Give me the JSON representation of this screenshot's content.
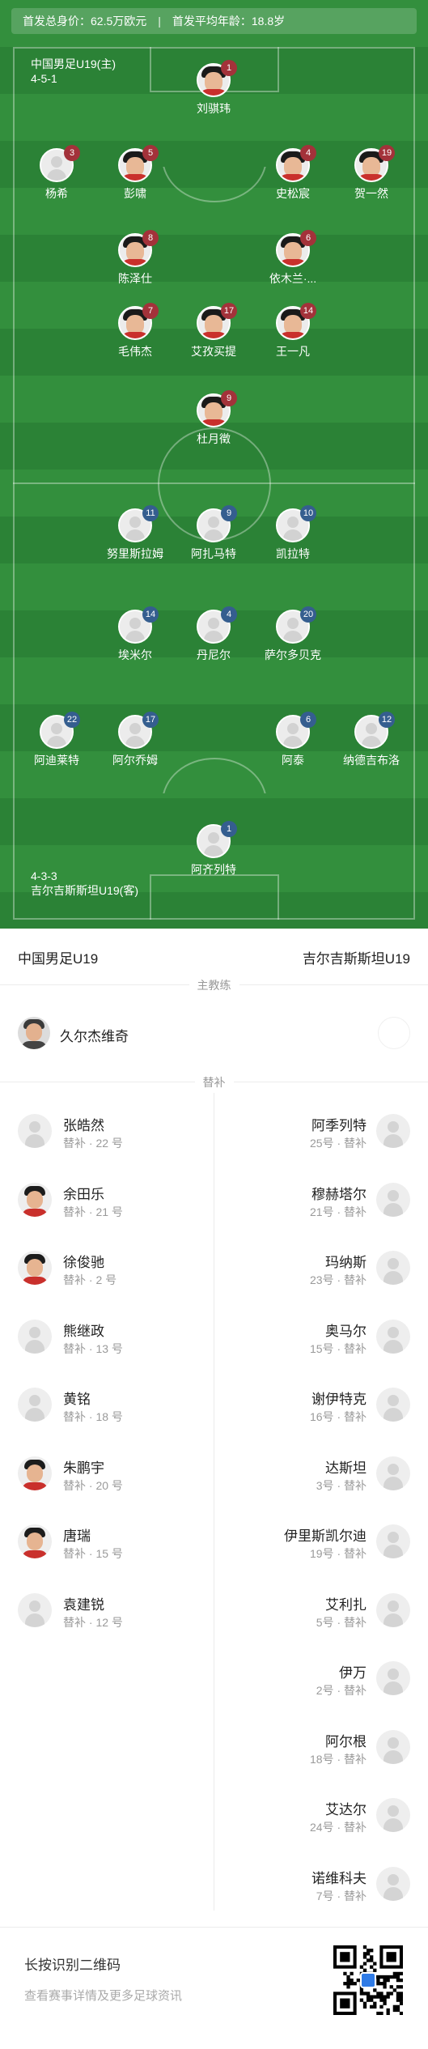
{
  "summary": {
    "total_value": "首发总身价：62.5万欧元",
    "separator": "|",
    "avg_age": "首发平均年龄：18.8岁"
  },
  "home": {
    "name": "中国男足U19(主)",
    "formation": "4-5-1",
    "players": [
      {
        "name": "刘骐玮",
        "number": "1",
        "photo": true
      },
      {
        "name": "杨希",
        "number": "3",
        "photo": false
      },
      {
        "name": "彭啸",
        "number": "5",
        "photo": true
      },
      {
        "name": "史松宸",
        "number": "4",
        "photo": true
      },
      {
        "name": "贺一然",
        "number": "19",
        "photo": true
      },
      {
        "name": "陈泽仕",
        "number": "8",
        "photo": true
      },
      {
        "name": "依木兰·...",
        "number": "6",
        "photo": true
      },
      {
        "name": "毛伟杰",
        "number": "7",
        "photo": true
      },
      {
        "name": "艾孜买提",
        "number": "17",
        "photo": true
      },
      {
        "name": "王一凡",
        "number": "14",
        "photo": true
      },
      {
        "name": "杜月徵",
        "number": "9",
        "photo": true
      }
    ]
  },
  "away": {
    "name": "吉尔吉斯斯坦U19(客)",
    "formation": "4-3-3",
    "players": [
      {
        "name": "努里斯拉姆",
        "number": "11"
      },
      {
        "name": "阿扎马特",
        "number": "9"
      },
      {
        "name": "凯拉特",
        "number": "10"
      },
      {
        "name": "埃米尔",
        "number": "14"
      },
      {
        "name": "丹尼尔",
        "number": "4"
      },
      {
        "name": "萨尔多贝克",
        "number": "20"
      },
      {
        "name": "阿迪莱特",
        "number": "22"
      },
      {
        "name": "阿尔乔姆",
        "number": "17"
      },
      {
        "name": "阿泰",
        "number": "6"
      },
      {
        "name": "纳德吉布洛",
        "number": "12"
      },
      {
        "name": "阿齐列特",
        "number": "1"
      }
    ]
  },
  "teams_header": {
    "left": "中国男足U19",
    "right": "吉尔吉斯斯坦U19"
  },
  "labels": {
    "coach": "主教练",
    "subs": "替补"
  },
  "coach": {
    "left_name": "久尔杰维奇"
  },
  "subs_left": [
    {
      "name": "张皓然",
      "meta": "替补 · 22 号",
      "photo": false
    },
    {
      "name": "余田乐",
      "meta": "替补 · 21 号",
      "photo": true
    },
    {
      "name": "徐俊驰",
      "meta": "替补 · 2 号",
      "photo": true
    },
    {
      "name": "熊继政",
      "meta": "替补 · 13 号",
      "photo": false
    },
    {
      "name": "黄铭",
      "meta": "替补 · 18 号",
      "photo": false
    },
    {
      "name": "朱鹏宇",
      "meta": "替补 · 20 号",
      "photo": true
    },
    {
      "name": "唐瑞",
      "meta": "替补 · 15 号",
      "photo": true
    },
    {
      "name": "袁建锐",
      "meta": "替补 · 12 号",
      "photo": false
    }
  ],
  "subs_right": [
    {
      "name": "阿季列特",
      "meta": "25号 · 替补"
    },
    {
      "name": "穆赫塔尔",
      "meta": "21号 · 替补"
    },
    {
      "name": "玛纳斯",
      "meta": "23号 · 替补"
    },
    {
      "name": "奥马尔",
      "meta": "15号 · 替补"
    },
    {
      "name": "谢伊特克",
      "meta": "16号 · 替补"
    },
    {
      "name": "达斯坦",
      "meta": "3号 · 替补"
    },
    {
      "name": "伊里斯凯尔迪",
      "meta": "19号 · 替补"
    },
    {
      "name": "艾利扎",
      "meta": "5号 · 替补"
    },
    {
      "name": "伊万",
      "meta": "2号 · 替补"
    },
    {
      "name": "阿尔根",
      "meta": "18号 · 替补"
    },
    {
      "name": "艾达尔",
      "meta": "24号 · 替补"
    },
    {
      "name": "诺维科夫",
      "meta": "7号 · 替补"
    }
  ],
  "footer": {
    "title": "长按识别二维码",
    "subtitle": "查看赛事详情及更多足球资讯"
  },
  "colors": {
    "home_badge": "#a3323a",
    "away_badge": "#355e8f",
    "pitch": "#2f8a3a"
  }
}
